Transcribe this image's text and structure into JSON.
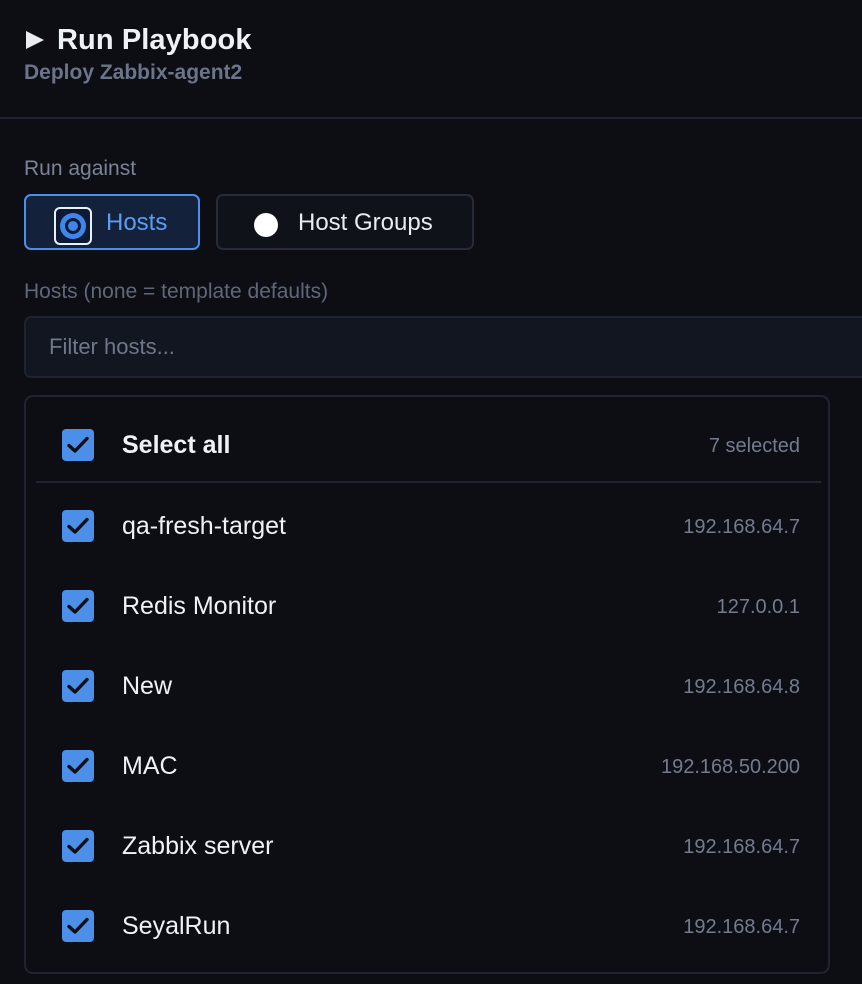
{
  "header": {
    "icon": "play-icon",
    "title": "Run Playbook",
    "subtitle": "Deploy Zabbix-agent2"
  },
  "run_against": {
    "label": "Run against",
    "options": [
      {
        "label": "Hosts",
        "selected": true
      },
      {
        "label": "Host Groups",
        "selected": false
      }
    ]
  },
  "hosts": {
    "label": "Hosts (none = template defaults)",
    "filter_placeholder": "Filter hosts...",
    "filter_value": "",
    "select_all": {
      "label": "Select all",
      "checked": true,
      "count_text": "7 selected"
    },
    "items": [
      {
        "name": "qa-fresh-target",
        "ip": "192.168.64.7",
        "checked": true
      },
      {
        "name": "Redis Monitor",
        "ip": "127.0.0.1",
        "checked": true
      },
      {
        "name": "New",
        "ip": "192.168.64.8",
        "checked": true
      },
      {
        "name": "MAC",
        "ip": "192.168.50.200",
        "checked": true
      },
      {
        "name": "Zabbix server",
        "ip": "192.168.64.7",
        "checked": true
      },
      {
        "name": "SeyalRun",
        "ip": "192.168.64.7",
        "checked": true
      }
    ]
  },
  "colors": {
    "accent": "#4b8fe9",
    "background": "#0c0e14",
    "muted": "#737b8d"
  }
}
